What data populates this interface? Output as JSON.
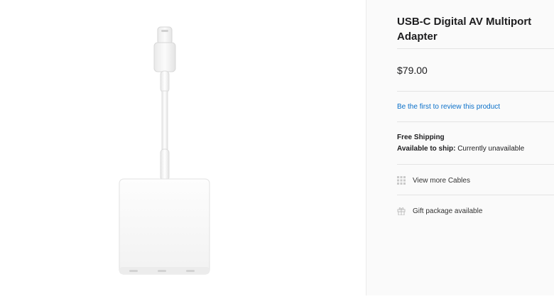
{
  "product": {
    "title": "USB-C Digital AV Multiport Adapter",
    "price": "$79.00",
    "review_link": "Be the first to review this product",
    "free_shipping": "Free Shipping",
    "availability_label": "Available to ship:",
    "availability_value": "Currently unavailable"
  },
  "links": {
    "more_cables": "View more Cables",
    "gift_package": "Gift package available"
  },
  "icons": {
    "more_cables": "grid-icon",
    "gift_package": "gift-icon"
  },
  "colors": {
    "link": "#0a70c9",
    "panel_bg": "#fafafa",
    "divider": "#e4e4e4"
  }
}
